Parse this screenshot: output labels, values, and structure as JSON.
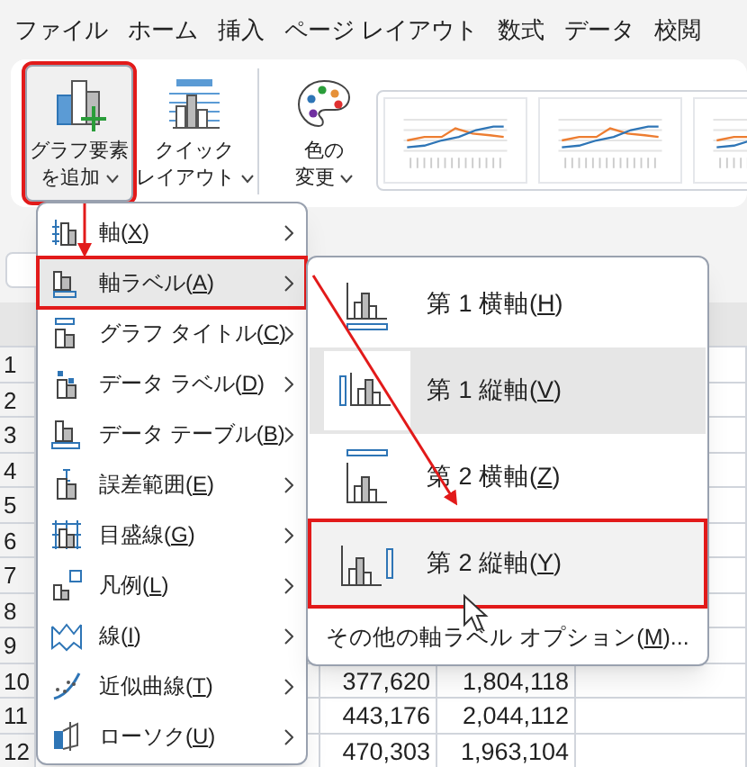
{
  "menu_tabs": [
    {
      "label": "ファイル"
    },
    {
      "label": "ホーム"
    },
    {
      "label": "挿入"
    },
    {
      "label": "ページ レイアウト"
    },
    {
      "label": "数式"
    },
    {
      "label": "データ"
    },
    {
      "label": "校閲"
    }
  ],
  "ribbon": {
    "buttons": [
      {
        "kind": "add_element",
        "lines": [
          "グラフ要素",
          "を追加"
        ],
        "selected": true,
        "annotated": true
      },
      {
        "kind": "quick_layout",
        "lines": [
          "クイック",
          "レイアウト"
        ],
        "selected": false,
        "annotated": false
      },
      {
        "kind": "colors",
        "lines": [
          "色の",
          "変更"
        ],
        "selected": false,
        "annotated": false
      }
    ],
    "style_gallery": [
      {
        "kind": "chart_thumbnail"
      },
      {
        "kind": "chart_thumbnail"
      },
      {
        "kind": "chart_thumbnail"
      }
    ]
  },
  "sheet": {
    "row_numbers": [
      "1",
      "2",
      "3",
      "4",
      "5",
      "6",
      "7",
      "8",
      "9",
      "10",
      "11",
      "12"
    ],
    "visible_rows": [
      {
        "cells": [
          "377,620",
          "1,804,118"
        ]
      },
      {
        "cells": [
          "443,176",
          "2,044,112"
        ]
      },
      {
        "cells": [
          "470,303",
          "1,963,104"
        ]
      }
    ]
  },
  "element_menu": [
    {
      "kind": "axis",
      "before": "軸(",
      "key": "X",
      "after": ")",
      "selected": false,
      "annotated": false
    },
    {
      "kind": "axis_title",
      "before": "軸ラベル(",
      "key": "A",
      "after": ")",
      "selected": true,
      "annotated": true
    },
    {
      "kind": "chart_title",
      "before": "グラフ タイトル(",
      "key": "C",
      "after": ")",
      "selected": false,
      "annotated": false
    },
    {
      "kind": "data_labels",
      "before": "データ ラベル(",
      "key": "D",
      "after": ")",
      "selected": false,
      "annotated": false
    },
    {
      "kind": "data_table",
      "before": "データ テーブル(",
      "key": "B",
      "after": ")",
      "selected": false,
      "annotated": false
    },
    {
      "kind": "error_bars",
      "before": "誤差範囲(",
      "key": "E",
      "after": ")",
      "selected": false,
      "annotated": false
    },
    {
      "kind": "gridlines",
      "before": "目盛線(",
      "key": "G",
      "after": ")",
      "selected": false,
      "annotated": false
    },
    {
      "kind": "legend",
      "before": "凡例(",
      "key": "L",
      "after": ")",
      "selected": false,
      "annotated": false
    },
    {
      "kind": "lines",
      "before": "線(",
      "key": "I",
      "after": ")",
      "selected": false,
      "annotated": false
    },
    {
      "kind": "trendline",
      "before": "近似曲線(",
      "key": "T",
      "after": ")",
      "selected": false,
      "annotated": false
    },
    {
      "kind": "updown",
      "before": "ローソク(",
      "key": "U",
      "after": ")",
      "selected": false,
      "annotated": false
    }
  ],
  "axis_title_submenu": {
    "items": [
      {
        "kind": "h1",
        "before": "第 1 横軸(",
        "key": "H",
        "after": ")",
        "checked": false,
        "selected": false,
        "annotated": false
      },
      {
        "kind": "v1",
        "before": "第 1 縦軸(",
        "key": "V",
        "after": ")",
        "checked": true,
        "selected": false,
        "annotated": false
      },
      {
        "kind": "h2",
        "before": "第 2 横軸(",
        "key": "Z",
        "after": ")",
        "checked": false,
        "selected": false,
        "annotated": false
      },
      {
        "kind": "v2",
        "before": "第 2 縦軸(",
        "key": "Y",
        "after": ")",
        "checked": false,
        "selected": true,
        "annotated": true
      }
    ],
    "more_options": {
      "before": "その他の軸ラベル オプション(",
      "key": "M",
      "after": ")..."
    }
  }
}
